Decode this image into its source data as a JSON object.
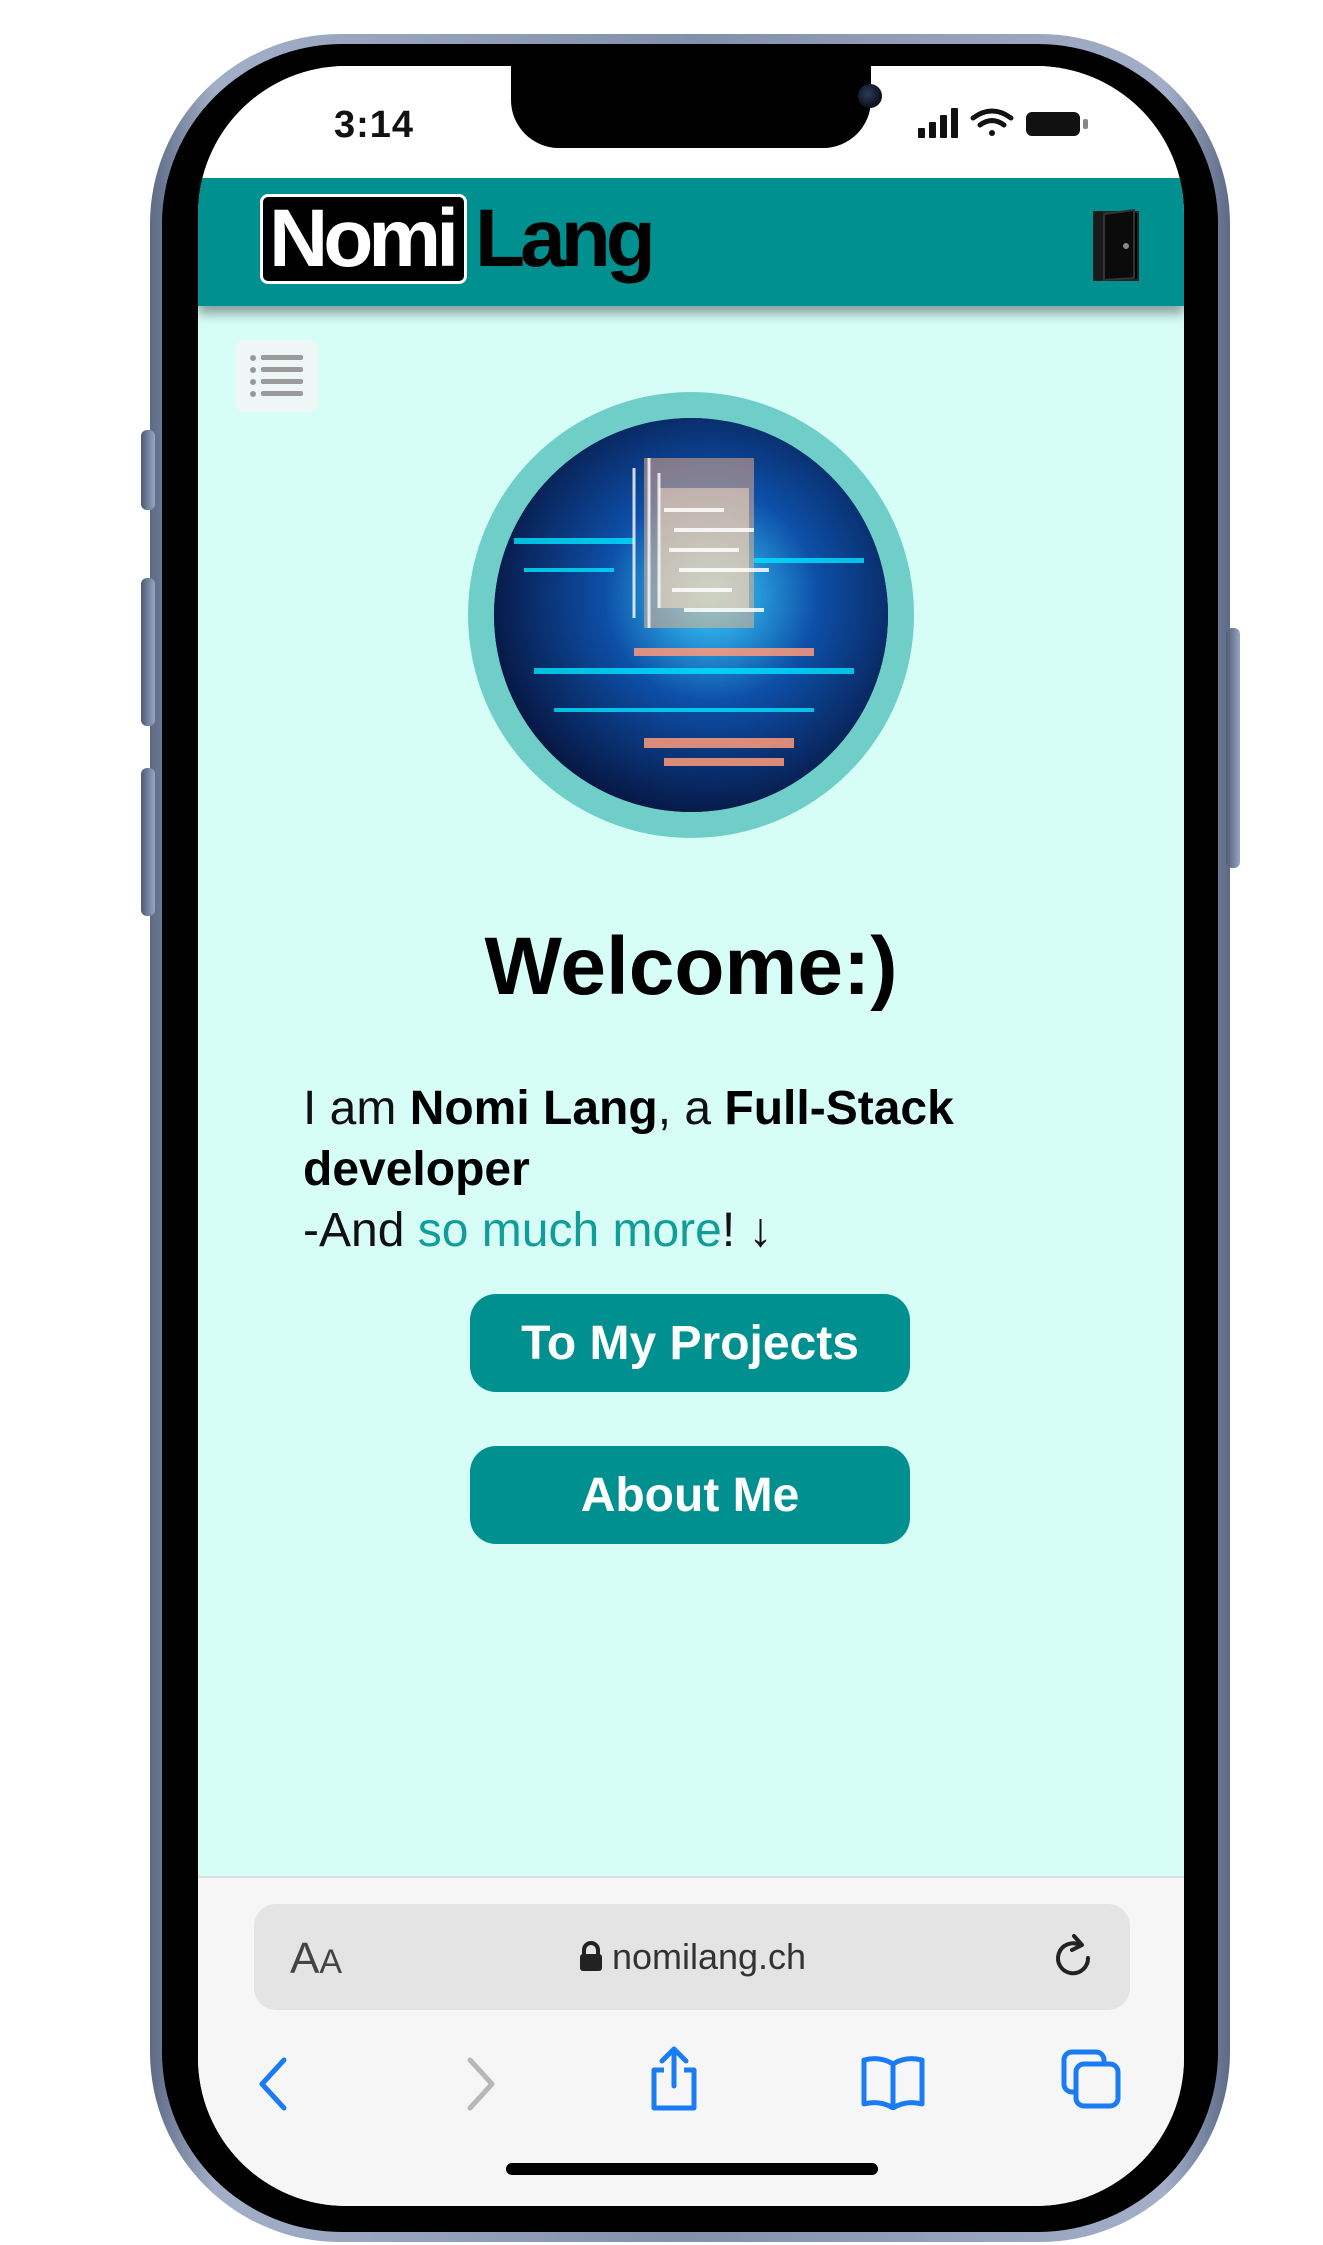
{
  "status_bar": {
    "time": "3:14"
  },
  "header": {
    "logo_boxed": "Nomi",
    "logo_plain": "Lang"
  },
  "main": {
    "welcome": "Welcome:)",
    "intro": {
      "prefix": "I am ",
      "name": "Nomi Lang",
      "middle": ", a ",
      "role": "Full-Stack developer",
      "line2_prefix": "-And ",
      "link": "so much more",
      "line2_suffix": "! ↓"
    },
    "buttons": {
      "projects": "To My Projects",
      "about": "About Me"
    }
  },
  "browser": {
    "aa_large": "A",
    "aa_small": "A",
    "url": "nomilang.ch"
  },
  "colors": {
    "header": "#009090",
    "page_background": "#d6fdf6",
    "link": "#119e98",
    "avatar_ring": "#6fcfc8",
    "safari_blue": "#1a7cf5"
  },
  "icons": [
    "signal-icon",
    "wifi-icon",
    "battery-icon",
    "door-exit-icon",
    "menu-list-icon",
    "lock-icon",
    "reload-icon",
    "back-icon",
    "forward-icon",
    "share-icon",
    "bookmarks-icon",
    "tabs-icon"
  ]
}
